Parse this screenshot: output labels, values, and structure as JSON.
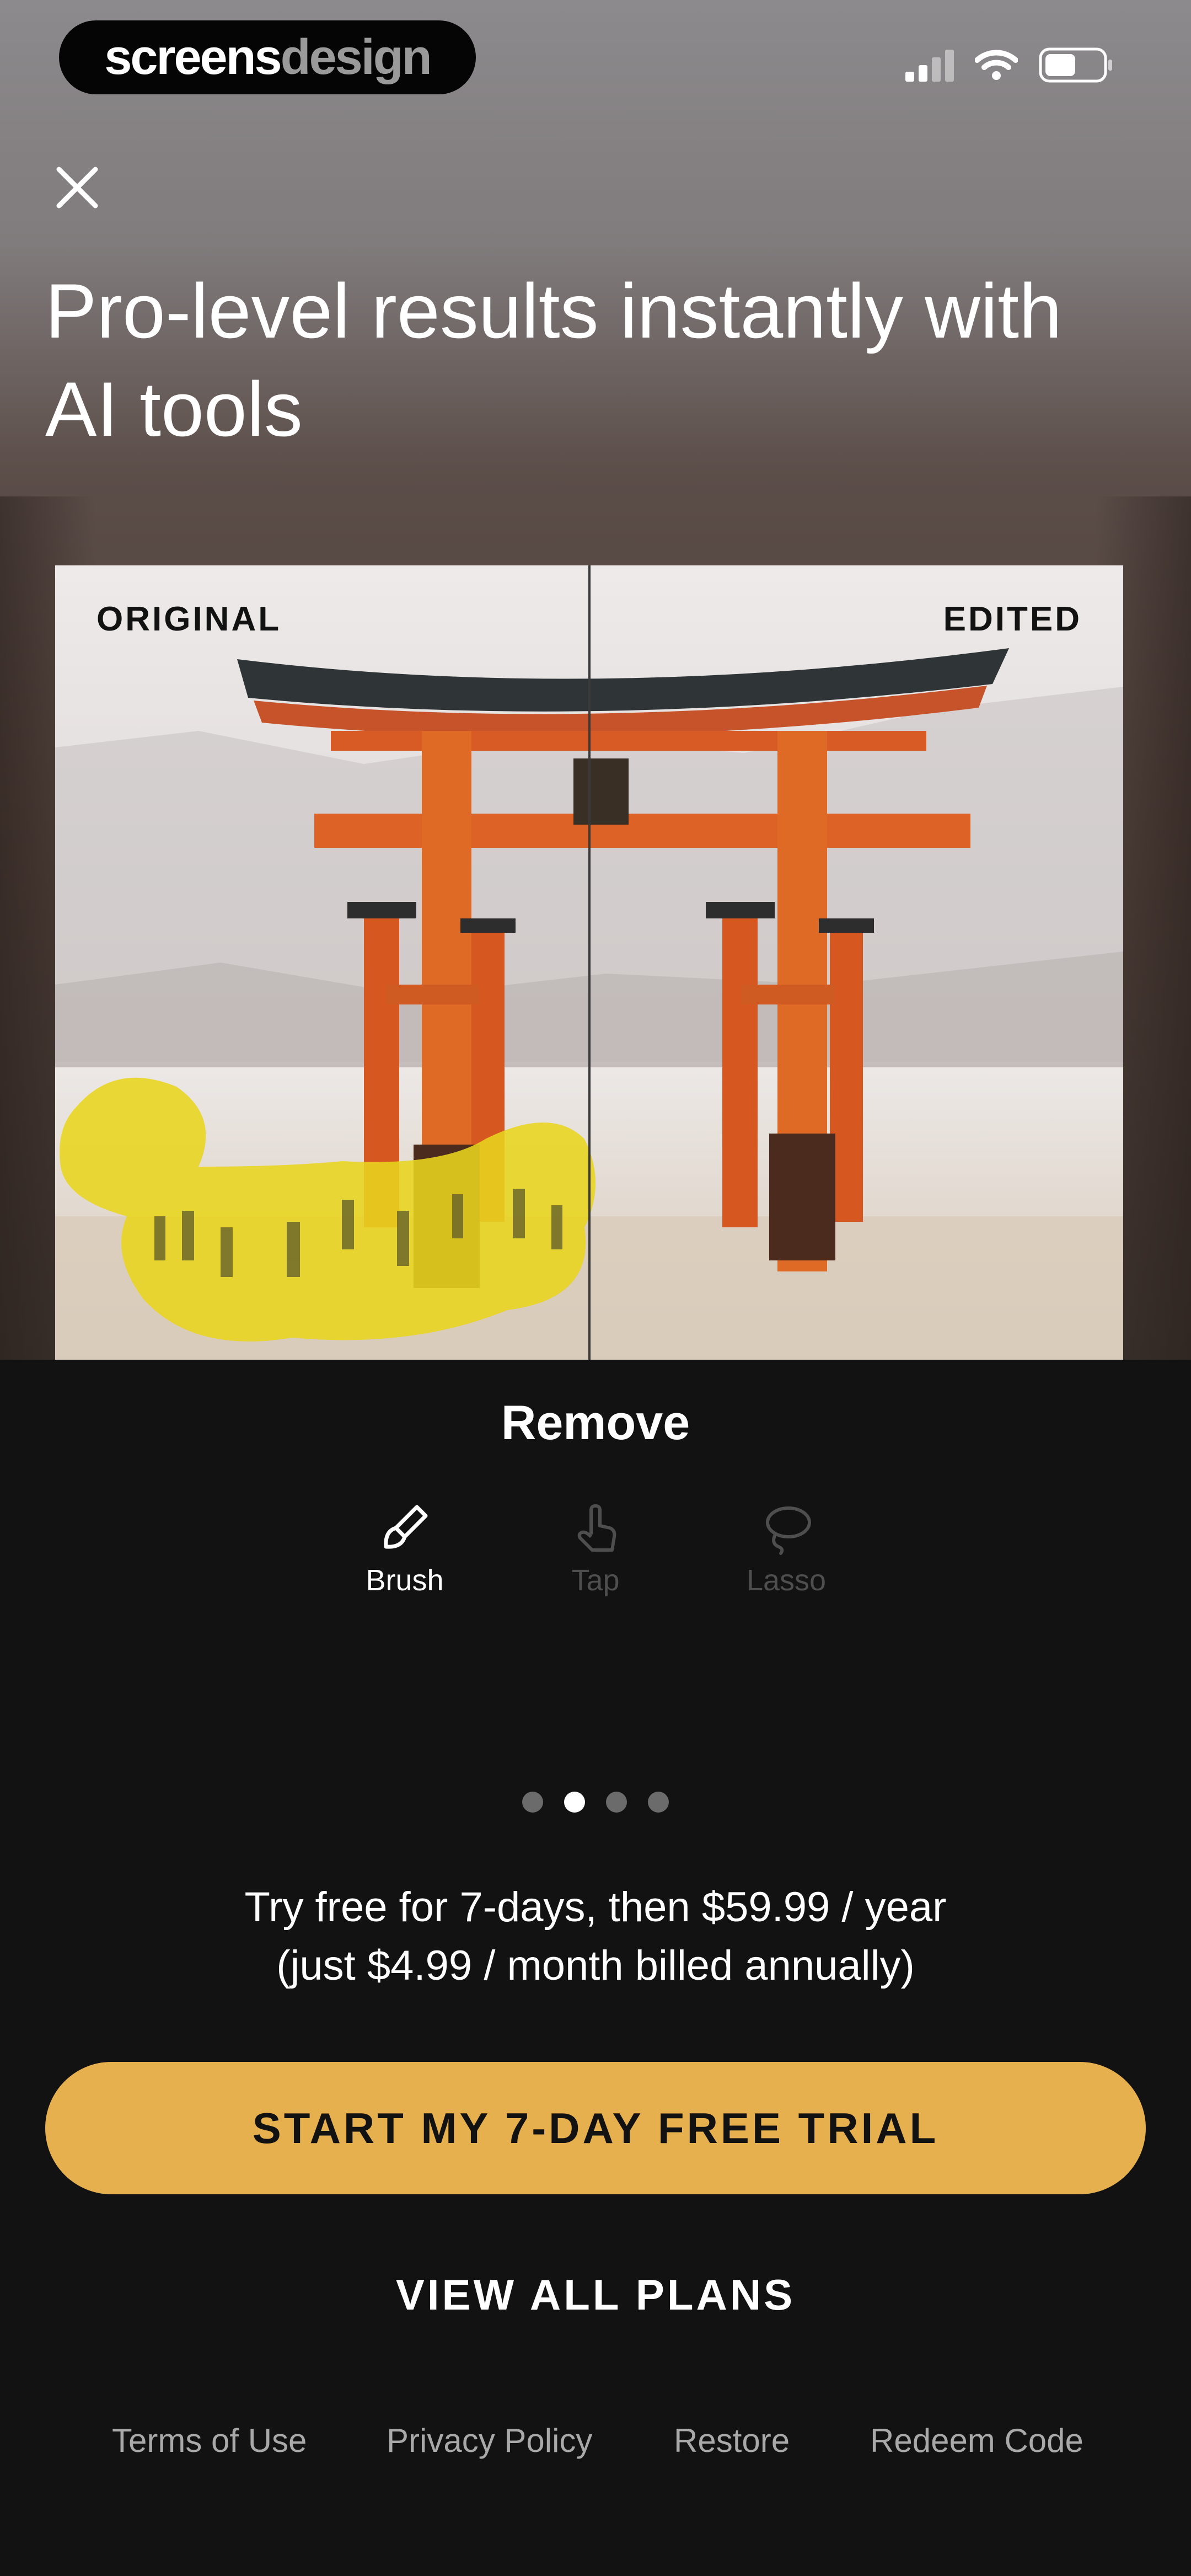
{
  "status_bar": {
    "brand_part1": "screens",
    "brand_part2": "design"
  },
  "header": {
    "close_icon": "close-icon",
    "title": "Pro-level results instantly with AI tools"
  },
  "comparison": {
    "left_label": "ORIGINAL",
    "right_label": "EDITED"
  },
  "feature": {
    "title": "Remove",
    "tools": [
      {
        "label": "Brush",
        "icon": "brush-icon",
        "active": true
      },
      {
        "label": "Tap",
        "icon": "tap-icon",
        "active": false
      },
      {
        "label": "Lasso",
        "icon": "lasso-icon",
        "active": false
      }
    ]
  },
  "pager": {
    "count": 4,
    "active_index": 1
  },
  "pricing": {
    "line1": "Try free for 7-days, then $59.99 / year",
    "line2": "(just $4.99 / month billed annually)"
  },
  "cta": {
    "label": "START MY 7-DAY FREE TRIAL"
  },
  "secondary": {
    "label": "VIEW ALL PLANS"
  },
  "footer": {
    "links": [
      "Terms of Use",
      "Privacy Policy",
      "Restore",
      "Redeem Code"
    ]
  },
  "colors": {
    "background": "#121212",
    "accent": "#e6b04f",
    "highlight": "#e8d51e",
    "gate": "#dd5a24"
  }
}
